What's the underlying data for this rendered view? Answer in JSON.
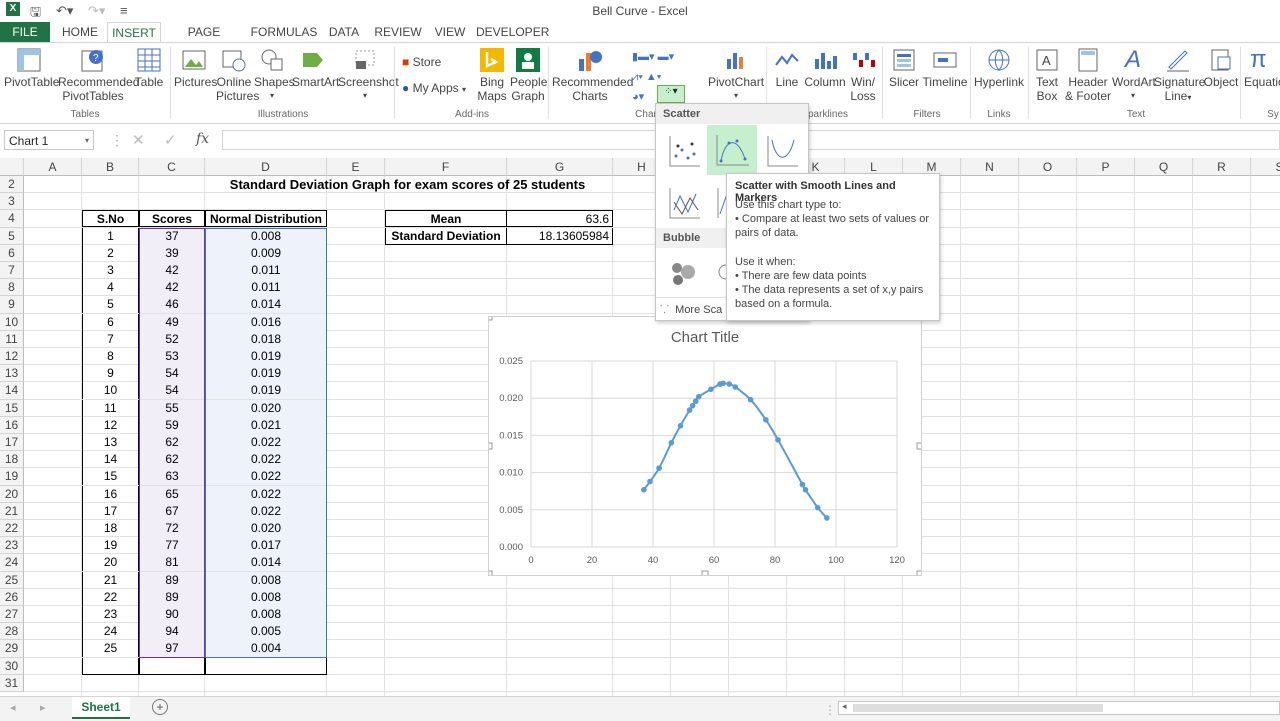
{
  "window": {
    "title": "Bell Curve - Excel"
  },
  "ribbon_tabs": [
    "FILE",
    "HOME",
    "INSERT",
    "PAGE LAYOUT",
    "FORMULAS",
    "DATA",
    "REVIEW",
    "VIEW",
    "DEVELOPER"
  ],
  "ribbon": {
    "pivottable": "PivotTable",
    "recommended_pivottables": [
      "Recommended",
      "PivotTables"
    ],
    "table": "Table",
    "pictures": "Pictures",
    "online_pictures": [
      "Online",
      "Pictures"
    ],
    "shapes": "Shapes",
    "smartart": "SmartArt",
    "screenshot": "Screenshot",
    "store": "Store",
    "my_apps": "My Apps",
    "bing_maps": [
      "Bing",
      "Maps"
    ],
    "people_graph": [
      "People",
      "Graph"
    ],
    "recommended_charts": [
      "Recommended",
      "Charts"
    ],
    "pivotchart": "PivotChart",
    "line": "Line",
    "column": "Column",
    "winloss": [
      "Win/",
      "Loss"
    ],
    "slicer": "Slicer",
    "timeline": "Timeline",
    "hyperlink": "Hyperlink",
    "textbox": [
      "Text",
      "Box"
    ],
    "header_footer": [
      "Header",
      "& Footer"
    ],
    "wordart": "WordArt",
    "signature_line": [
      "Signature",
      "Line"
    ],
    "object": "Object",
    "equation": "Equatio",
    "groups": {
      "tables": "Tables",
      "illustrations": "Illustrations",
      "addins": "Add-ins",
      "charts": "Char",
      "sparklines": "parklines",
      "filters": "Filters",
      "links": "Links",
      "text": "Text",
      "symbols": "Sy"
    }
  },
  "formula_bar": {
    "name_box": "Chart 1",
    "fx": "fx",
    "cancel": "✕",
    "enter": "✓"
  },
  "columns": [
    "A",
    "B",
    "C",
    "D",
    "E",
    "F",
    "G",
    "H",
    "I",
    "J",
    "K",
    "L",
    "M",
    "N",
    "O",
    "P",
    "Q",
    "R",
    "S"
  ],
  "rows": [
    2,
    3,
    4,
    5,
    6,
    7,
    8,
    9,
    10,
    11,
    12,
    13,
    14,
    15,
    16,
    17,
    18,
    19,
    20,
    21,
    22,
    23,
    24,
    25,
    26,
    27,
    28,
    29,
    30,
    31
  ],
  "sheet": {
    "heading": "Standard Deviation Graph for exam scores of 25 students",
    "table_headers": [
      "S.No",
      "Scores",
      "Normal Distribution"
    ],
    "table_rows": [
      [
        "1",
        "37",
        "0.008"
      ],
      [
        "2",
        "39",
        "0.009"
      ],
      [
        "3",
        "42",
        "0.011"
      ],
      [
        "4",
        "42",
        "0.011"
      ],
      [
        "5",
        "46",
        "0.014"
      ],
      [
        "6",
        "49",
        "0.016"
      ],
      [
        "7",
        "52",
        "0.018"
      ],
      [
        "8",
        "53",
        "0.019"
      ],
      [
        "9",
        "54",
        "0.019"
      ],
      [
        "10",
        "54",
        "0.019"
      ],
      [
        "11",
        "55",
        "0.020"
      ],
      [
        "12",
        "59",
        "0.021"
      ],
      [
        "13",
        "62",
        "0.022"
      ],
      [
        "14",
        "62",
        "0.022"
      ],
      [
        "15",
        "63",
        "0.022"
      ],
      [
        "16",
        "65",
        "0.022"
      ],
      [
        "17",
        "67",
        "0.022"
      ],
      [
        "18",
        "72",
        "0.020"
      ],
      [
        "19",
        "77",
        "0.017"
      ],
      [
        "20",
        "81",
        "0.014"
      ],
      [
        "21",
        "89",
        "0.008"
      ],
      [
        "22",
        "89",
        "0.008"
      ],
      [
        "23",
        "90",
        "0.008"
      ],
      [
        "24",
        "94",
        "0.005"
      ],
      [
        "25",
        "97",
        "0.004"
      ]
    ],
    "stats": [
      {
        "label": "Mean",
        "value": "63.6"
      },
      {
        "label": "Standard Deviation",
        "value": "18.13605984"
      }
    ]
  },
  "dropdown": {
    "scatter_header": "Scatter",
    "bubble_header": "Bubble",
    "more": "More Sca"
  },
  "tooltip": {
    "title": "Scatter with Smooth Lines and Markers",
    "line1": "Use this chart type to:",
    "line2": "• Compare at least two sets of values or",
    "line3": "pairs of data.",
    "line4": "Use it when:",
    "line5": "• There are few data points",
    "line6": "• The data represents a set of x,y pairs",
    "line7": "based on a formula."
  },
  "chart_data": {
    "type": "scatter",
    "title": "Chart Title",
    "x": [
      37,
      39,
      42,
      42,
      46,
      49,
      52,
      53,
      54,
      54,
      55,
      59,
      62,
      62,
      63,
      65,
      67,
      72,
      77,
      81,
      89,
      89,
      90,
      94,
      97
    ],
    "y": [
      0.0077,
      0.0088,
      0.0106,
      0.0106,
      0.014,
      0.0163,
      0.0184,
      0.019,
      0.0196,
      0.0196,
      0.0202,
      0.0212,
      0.0219,
      0.0219,
      0.022,
      0.0219,
      0.0215,
      0.0198,
      0.0171,
      0.0144,
      0.0084,
      0.0084,
      0.0077,
      0.0053,
      0.0039
    ],
    "xlim": [
      0,
      120
    ],
    "ylim": [
      0,
      0.025
    ],
    "x_ticks": [
      "0",
      "20",
      "40",
      "60",
      "80",
      "100",
      "120"
    ],
    "y_ticks": [
      "0.000",
      "0.005",
      "0.010",
      "0.015",
      "0.020",
      "0.025"
    ],
    "smooth_lines": true,
    "markers": true,
    "grid": true,
    "color": "#5b9bd5"
  },
  "sheet_tab": "Sheet1",
  "colors": {
    "excel_green": "#217346",
    "selection_purple": "#7030a0",
    "selection_blue": "#4472c4"
  }
}
